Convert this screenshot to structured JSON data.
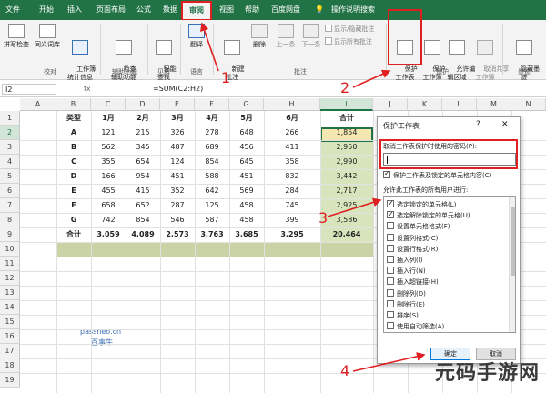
{
  "tabs": [
    "文件",
    "开始",
    "插入",
    "页面布局",
    "公式",
    "数据",
    "审阅",
    "视图",
    "帮助",
    "百度网盘",
    "操作说明搜索"
  ],
  "active_tab": "审阅",
  "ribbon": {
    "spell": "拼写检查",
    "thesaurus": "同义词库",
    "stats": "工作簿\n统计信息",
    "proofing": "校对",
    "access_check": "检查\n辅助功能",
    "accessibility": "辅助功能",
    "smart_lookup": "智能\n查找",
    "insights": "见解",
    "translate": "翻译",
    "language": "语言",
    "new_comment": "新建\n批注",
    "delete": "删除",
    "prev": "上一条",
    "next": "下一条",
    "show_hide": "显示/隐藏批注",
    "show_all": "显示所有批注",
    "comments": "批注",
    "protect_sheet": "保护\n工作表",
    "protect_wb": "保护\n工作簿",
    "allow_edit": "允许编\n辑区域",
    "unshare": "取消共享\n工作簿",
    "protect": "保护",
    "hide_ink": "隐藏墨\n迹",
    "ink": "墨迹"
  },
  "formula_bar": {
    "name_box": "I2",
    "fx": "fx",
    "formula": "=SUM(C2:H2)"
  },
  "sheet": {
    "columns": [
      "A",
      "B",
      "C",
      "D",
      "E",
      "F",
      "G",
      "H",
      "I",
      "J",
      "K",
      "L",
      "M",
      "N"
    ],
    "rows": [
      "1",
      "2",
      "3",
      "4",
      "5",
      "6",
      "7",
      "8",
      "9",
      "10",
      "11",
      "12",
      "13",
      "14",
      "15",
      "16",
      "17",
      "18",
      "19"
    ],
    "header": [
      "类型",
      "1月",
      "2月",
      "3月",
      "4月",
      "5月",
      "6月",
      "合计"
    ],
    "data": [
      [
        "A",
        "121",
        "215",
        "326",
        "278",
        "648",
        "266",
        "1,854"
      ],
      [
        "B",
        "562",
        "345",
        "487",
        "689",
        "456",
        "411",
        "2,950"
      ],
      [
        "C",
        "355",
        "654",
        "124",
        "854",
        "645",
        "358",
        "2,990"
      ],
      [
        "D",
        "166",
        "954",
        "451",
        "588",
        "451",
        "832",
        "3,442"
      ],
      [
        "E",
        "455",
        "415",
        "352",
        "642",
        "569",
        "284",
        "2,717"
      ],
      [
        "F",
        "658",
        "652",
        "287",
        "125",
        "458",
        "745",
        "2,925"
      ],
      [
        "G",
        "742",
        "854",
        "546",
        "587",
        "458",
        "399",
        "3,586"
      ]
    ],
    "total": [
      "合计",
      "3,059",
      "4,089",
      "2,573",
      "3,763",
      "3,685",
      "3,295",
      "20,464"
    ]
  },
  "watermark": {
    "line1": "passneo.cn",
    "line2": "百事牛",
    "corner": "元码手游网"
  },
  "dialog": {
    "title": "保护工作表",
    "help": "?",
    "close": "✕",
    "password_label": "取消工作表保护时使用的密码(P):",
    "protect_check": "保护工作表及锁定的单元格内容(C)",
    "allow_label": "允许此工作表的所有用户进行:",
    "options": [
      {
        "label": "选定锁定的单元格(L)",
        "checked": true
      },
      {
        "label": "选定解除锁定的单元格(U)",
        "checked": true
      },
      {
        "label": "设置单元格格式(F)",
        "checked": false
      },
      {
        "label": "设置列格式(C)",
        "checked": false
      },
      {
        "label": "设置行格式(R)",
        "checked": false
      },
      {
        "label": "插入列(I)",
        "checked": false
      },
      {
        "label": "插入行(N)",
        "checked": false
      },
      {
        "label": "插入超链接(H)",
        "checked": false
      },
      {
        "label": "删除列(D)",
        "checked": false
      },
      {
        "label": "删除行(E)",
        "checked": false
      },
      {
        "label": "排序(S)",
        "checked": false
      },
      {
        "label": "使用自动筛选(A)",
        "checked": false
      }
    ],
    "ok": "确定",
    "cancel": "取消"
  },
  "annotations": [
    "1",
    "2",
    "3",
    "4"
  ],
  "colors": {
    "excel_green": "#217346",
    "annotation_red": "#e02020",
    "sum_fill": "#d7e4bc",
    "total_fill": "#c9d3a6"
  }
}
